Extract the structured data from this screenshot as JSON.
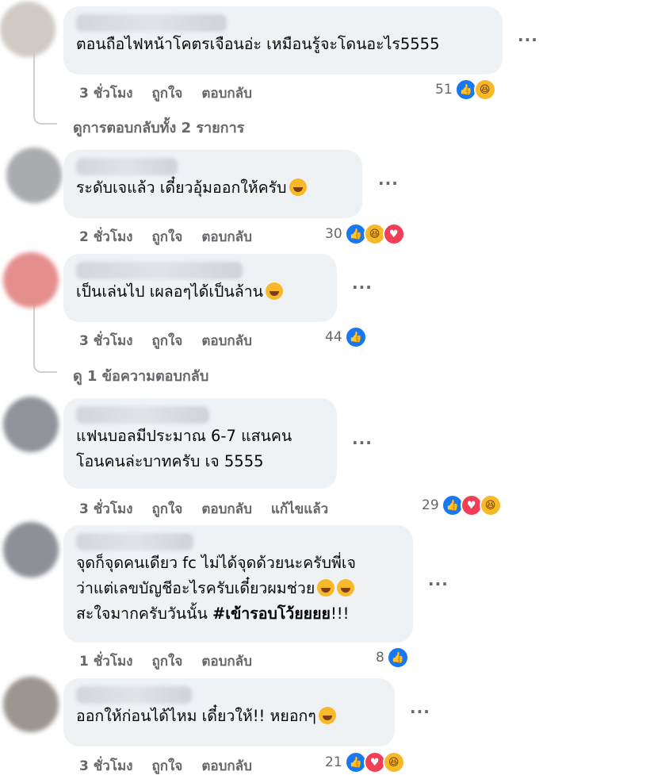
{
  "comments": [
    {
      "text": "ตอนถือไฟหน้าโคตรเจือนอ่ะ เหมือนรู้จะโดนอะไร5555",
      "time": "3 ชั่วโมง",
      "like": "ถูกใจ",
      "reply": "ตอบกลับ",
      "reaction_count": "51",
      "reactions": [
        "like",
        "haha"
      ],
      "avatar_color": "#c9c4bf"
    },
    {
      "text": "ระดับเจแล้ว เดี๋ยวอุ้มออกให้ครับ",
      "time": "2 ชั่วโมง",
      "like": "ถูกใจ",
      "reply": "ตอบกลับ",
      "reaction_count": "30",
      "reactions": [
        "like",
        "haha",
        "love"
      ],
      "avatar_color": "#a7a9ad"
    },
    {
      "text": "เป็นเล่นไป เผลอๆได้เป็นล้าน",
      "time": "3 ชั่วโมง",
      "like": "ถูกใจ",
      "reply": "ตอบกลับ",
      "reaction_count": "44",
      "reactions": [
        "like"
      ],
      "avatar_color": "#e08a8a"
    },
    {
      "text_line1": "แฟนบอลมีประมาณ 6-7 แสนคน",
      "text_line2": "โอนคนล่ะบาทครับ เจ 5555",
      "time": "3 ชั่วโมง",
      "like": "ถูกใจ",
      "reply": "ตอบกลับ",
      "edited": "แก้ไขแล้ว",
      "reaction_count": "29",
      "reactions": [
        "like",
        "love",
        "haha"
      ],
      "avatar_color": "#8f9399"
    },
    {
      "text_line1": "จุดก็จุดคนเดียว fc ไม่ได้จุดด้วยนะครับพี่เจ",
      "text_line2": "ว่าแต่เลขบัญชีอะไรครับเดี๋ยวผมช่วย",
      "text_line3_plain": "สะใจมากครับวันนั้น ",
      "text_line3_bold": "#เข้ารอบโว้ยยยย",
      "text_line3_end": "!!!",
      "time": "1 ชั่วโมง",
      "like": "ถูกใจ",
      "reply": "ตอบกลับ",
      "reaction_count": "8",
      "reactions": [
        "like"
      ],
      "avatar_color": "#8c9096"
    },
    {
      "text": "ออกให้ก่อนได้ไหม เดี๋ยวให้!! หยอกๆ",
      "time": "3 ชั่วโมง",
      "like": "ถูกใจ",
      "reply": "ตอบกลับ",
      "reaction_count": "21",
      "reactions": [
        "like",
        "love",
        "haha"
      ],
      "avatar_color": "#9a9591"
    }
  ],
  "view_replies_1": "ดูการตอบกลับทั้ง 2 รายการ",
  "view_replies_2": "ดู 1 ข้อความตอบกลับ",
  "more_options": "···",
  "colors": {
    "like": "#1877f2",
    "love": "#f33e58",
    "haha": "#f7b928",
    "bubble": "#eff2f5",
    "meta": "#65676b"
  }
}
